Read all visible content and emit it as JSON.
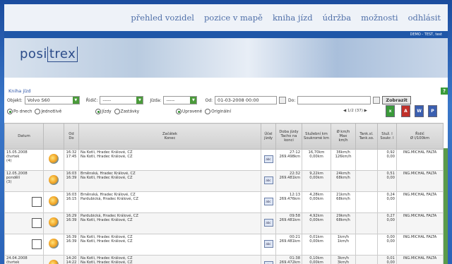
{
  "nav": {
    "items": [
      "přehled vozidel",
      "pozice v mapě",
      "kniha jízd",
      "údržba",
      "možnosti",
      "odhlásit"
    ]
  },
  "userbar": "DEMO - TEST, test",
  "logo": {
    "text_a": "posi",
    "text_b": "trex"
  },
  "page_title": "Kniha jízd",
  "help_label": "?",
  "filters": {
    "objekt_label": "Objekt:",
    "objekt_value": "Volvo S60",
    "ridic_label": "Řidič:",
    "ridic_value": "-----",
    "jizda_label": "Jízda:",
    "jizda_value": "-----",
    "od_label": "Od:",
    "od_value": "01-03-2008 00:00",
    "do_label": "Do:",
    "do_value": "",
    "submit_label": "Zobrazit"
  },
  "options": {
    "po_dnech": "Po dnech",
    "jednotlive": "Jednotlivě",
    "jizdy": "Jízdy",
    "zastavky": "Zastávky",
    "upravene": "Upravené",
    "originalni": "Originální",
    "pager": "1/2 (37)"
  },
  "columns": [
    "Datum",
    "",
    "Od\nDo",
    "Začátek\nKonec",
    "Účel\njízdy",
    "Doba jízdy\nTacho na\nkonci",
    "Služební km\nSoukromé km",
    "Ø km/h\nMax\nkm/h",
    "Tank.sl.\nTank.so.",
    "Služ. l\nSoukr. l",
    "Řidič\nØ l/100km"
  ],
  "rows": [
    {
      "date": "15.05.2008",
      "day": "čtvrtek",
      "count": "(4)",
      "od": "16:32",
      "do": "17:45",
      "start": "Na Kotli, Hradec Králové, CZ",
      "end": "Na Kotli, Hradec Králové, CZ",
      "doba": "27:12",
      "tacho": "269.498km",
      "sl": "16,70km",
      "so": "0,00km",
      "avg": "36km/h",
      "max": "126km/h",
      "tsl": "",
      "tso": "",
      "sluz_l": "0,92",
      "soukr_l": "0,00",
      "ridic": "ING.MICHAL FALTA"
    },
    {
      "date": "12.05.2008",
      "day": "pondělí",
      "count": "(3)",
      "od": "16:03",
      "do": "16:39",
      "start": "Brněnská, Hradec Králové, CZ",
      "end": "Na Kotli, Hradec Králové, CZ",
      "doba": "22:32",
      "tacho": "269.481km",
      "sl": "9,22km",
      "so": "0,00km",
      "avg": "24km/h",
      "max": "68km/h",
      "tsl": "",
      "tso": "",
      "sluz_l": "0,51",
      "soukr_l": "0,00",
      "ridic": "ING.MICHAL FALTA"
    },
    {
      "date": "",
      "day": "",
      "count": "",
      "od": "16:03",
      "do": "16:15",
      "start": "Brněnská, Hradec Králové, CZ",
      "end": "Pardubická, Hradec Králové, CZ",
      "doba": "12:13",
      "tacho": "269.476km",
      "sl": "4,28km",
      "so": "0,00km",
      "avg": "21km/h",
      "max": "68km/h",
      "tsl": "",
      "tso": "",
      "sluz_l": "0,24",
      "soukr_l": "0,00",
      "ridic": "ING.MICHAL FALTA"
    },
    {
      "date": "",
      "day": "",
      "count": "",
      "od": "16:29",
      "do": "16:39",
      "start": "Pardubická, Hradec Králové, CZ",
      "end": "Na Kotli, Hradec Králové, CZ",
      "doba": "09:58",
      "tacho": "269.481km",
      "sl": "4,92km",
      "so": "0,00km",
      "avg": "29km/h",
      "max": "68km/h",
      "tsl": "",
      "tso": "",
      "sluz_l": "0,27",
      "soukr_l": "0,00",
      "ridic": "ING.MICHAL FALTA"
    },
    {
      "date": "",
      "day": "",
      "count": "",
      "od": "16:39",
      "do": "16:39",
      "start": "Na Kotli, Hradec Králové, CZ",
      "end": "Na Kotli, Hradec Králové, CZ",
      "doba": "00:21",
      "tacho": "269.481km",
      "sl": "0,01km",
      "so": "0,00km",
      "avg": "1km/h",
      "max": "1km/h",
      "tsl": "",
      "tso": "",
      "sluz_l": "0,00",
      "soukr_l": "0,00",
      "ridic": "ING.MICHAL FALTA"
    },
    {
      "date": "24.04.2008",
      "day": "čtvrtek",
      "count": "",
      "od": "14:20",
      "do": "14:22",
      "start": "Na Kotli, Hradec Králové, CZ",
      "end": "Na Kotli, Hradec Králové, CZ",
      "doba": "01:38",
      "tacho": "269.472km",
      "sl": "0,10km",
      "so": "0,00km",
      "avg": "3km/h",
      "max": "3km/h",
      "tsl": "",
      "tso": "",
      "sluz_l": "0,01",
      "soukr_l": "0,00",
      "ridic": "ING.MICHAL FALTA"
    }
  ]
}
